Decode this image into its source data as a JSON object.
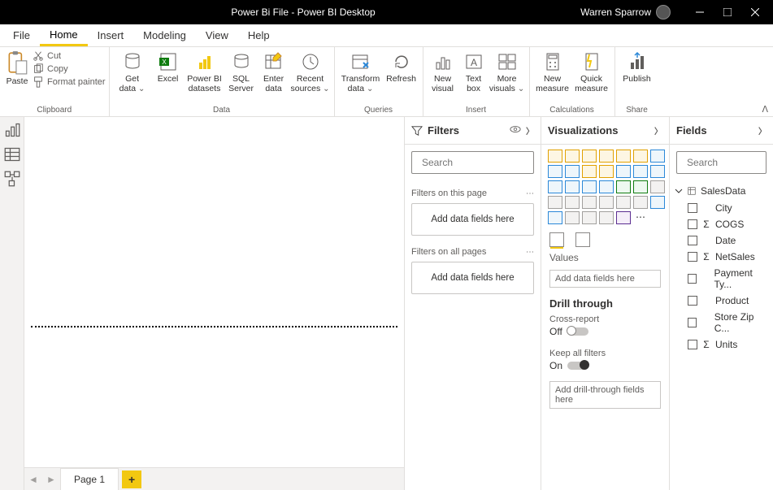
{
  "titlebar": {
    "title": "Power Bi File - Power BI Desktop",
    "user": "Warren Sparrow"
  },
  "tabs": {
    "file": "File",
    "home": "Home",
    "insert": "Insert",
    "modeling": "Modeling",
    "view": "View",
    "help": "Help"
  },
  "ribbon": {
    "clipboard": {
      "label": "Clipboard",
      "paste": "Paste",
      "cut": "Cut",
      "copy": "Copy",
      "format_painter": "Format painter"
    },
    "data": {
      "label": "Data",
      "get_data": "Get",
      "get_data2": "data",
      "excel": "Excel",
      "pbi_datasets": "Power BI",
      "pbi_datasets2": "datasets",
      "sql_server": "SQL",
      "sql_server2": "Server",
      "enter_data": "Enter",
      "enter_data2": "data",
      "recent_sources": "Recent",
      "recent_sources2": "sources"
    },
    "queries": {
      "label": "Queries",
      "transform": "Transform",
      "transform2": "data",
      "refresh": "Refresh"
    },
    "insert": {
      "label": "Insert",
      "new_visual": "New",
      "new_visual2": "visual",
      "text_box": "Text",
      "text_box2": "box",
      "more_visuals": "More",
      "more_visuals2": "visuals"
    },
    "calculations": {
      "label": "Calculations",
      "new_measure": "New",
      "new_measure2": "measure",
      "quick_measure": "Quick",
      "quick_measure2": "measure"
    },
    "share": {
      "label": "Share",
      "publish": "Publish"
    }
  },
  "filters": {
    "header": "Filters",
    "search_placeholder": "Search",
    "this_page": "Filters on this page",
    "all_pages": "Filters on all pages",
    "dropzone": "Add data fields here"
  },
  "visualizations": {
    "header": "Visualizations",
    "values": "Values",
    "values_drop": "Add data fields here",
    "drill_header": "Drill through",
    "cross_report": "Cross-report",
    "cross_report_state": "Off",
    "keep_filters": "Keep all filters",
    "keep_filters_state": "On",
    "drill_drop": "Add drill-through fields here"
  },
  "fields": {
    "header": "Fields",
    "search_placeholder": "Search",
    "table": "SalesData",
    "items": [
      {
        "name": "City",
        "agg": false
      },
      {
        "name": "COGS",
        "agg": true
      },
      {
        "name": "Date",
        "agg": false
      },
      {
        "name": "NetSales",
        "agg": true
      },
      {
        "name": "Payment Ty...",
        "agg": false
      },
      {
        "name": "Product",
        "agg": false
      },
      {
        "name": "Store Zip C...",
        "agg": false
      },
      {
        "name": "Units",
        "agg": true
      }
    ]
  },
  "pages": {
    "page1": "Page 1"
  }
}
